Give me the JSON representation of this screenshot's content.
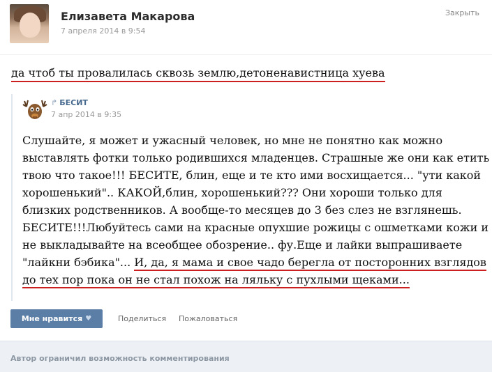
{
  "post": {
    "author_name": "Елизавета Макарова",
    "date": "7 апреля 2014 в 9:54",
    "close_label": "Закрыть",
    "text": "да чтоб ты провалилась сквозь землю,детоненавистница хуева"
  },
  "repost": {
    "source_name": "БЕСИТ",
    "date": "7 апр 2014 в 9:35",
    "lines": [
      "Слушайте, я может и ужасный человек, но мне не понятно как можно",
      "выставлять фотки только родившихся младенцев. Страшные же они как етить",
      "твою что такое!!! БЕСИТЕ, блин, еще и те кто ими восхищается... \"ути какой",
      "хорошенький\".. КАКОЙ,блин, хорошенький??? Они хороши только для",
      "близких родственников. А вообще-то месяцев до 3 без слез не взглянешь.",
      "БЕСИТЕ!!!Любуйтесь сами на красные опухшие рожицы с ошметками кожи и",
      "не выкладывайте на всеобщее обозрение.. фу.Еще и лайки выпрашиваете"
    ],
    "line8_plain": "\"лайкни бэбика\"... ",
    "line8_highlight": "И, да, я мама и свое чадо берегла от посторонних взглядов",
    "line9_highlight": "до тех пор пока он не стал похож на ляльку с пухлыми щеками..."
  },
  "actions": {
    "like_label": "Мне нравится",
    "share_label": "Поделиться",
    "report_label": "Пожаловаться"
  },
  "footer": {
    "text": "Автор ограничил возможность комментирования"
  },
  "colors": {
    "accent": "#45688e",
    "like_button": "#5b7ea6",
    "underline": "#cc1f1f"
  }
}
